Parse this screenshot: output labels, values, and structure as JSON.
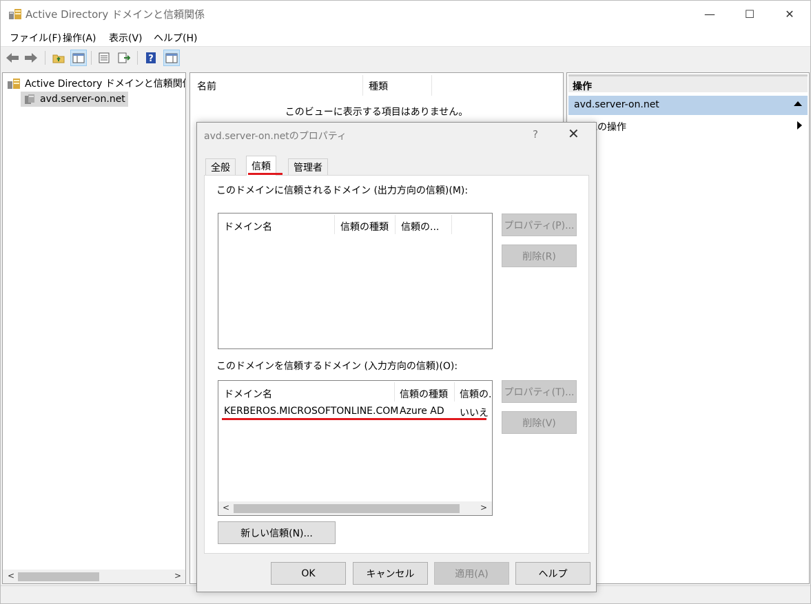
{
  "window": {
    "title": "Active Directory ドメインと信頼関係",
    "controls": {
      "minimize": "—",
      "maximize": "☐",
      "close": "✕"
    }
  },
  "menu": {
    "items": [
      "ファイル(F)",
      "操作(A)",
      "表示(V)",
      "ヘルプ(H)"
    ]
  },
  "toolbar": {
    "icons": [
      "back-arrow-icon",
      "forward-arrow-icon",
      "up-folder-icon",
      "show-tree-icon",
      "properties-icon",
      "export-list-icon",
      "help-icon",
      "show-action-pane-icon"
    ]
  },
  "tree": {
    "root_label": "Active Directory ドメインと信頼関係 [ A",
    "child_label": "avd.server-on.net"
  },
  "list": {
    "columns": [
      "名前",
      "種類"
    ],
    "empty_message": "このビューに表示する項目はありません。"
  },
  "actions": {
    "header": "操作",
    "domain": "avd.server-on.net",
    "other_actions": "他の操作"
  },
  "dialog": {
    "title": "avd.server-on.netのプロパティ",
    "help": "?",
    "close": "✕",
    "tabs": [
      "全般",
      "信頼",
      "管理者"
    ],
    "selected_tab": "信頼",
    "outgoing": {
      "label": "このドメインに信頼されるドメイン (出力方向の信頼)(M):",
      "columns": [
        "ドメイン名",
        "信頼の種類",
        "信頼の..."
      ],
      "rows": [],
      "properties_button": "プロパティ(P)...",
      "remove_button": "削除(R)"
    },
    "incoming": {
      "label": "このドメインを信頼するドメイン (入力方向の信頼)(O):",
      "columns": [
        "ドメイン名",
        "信頼の種類",
        "信頼の."
      ],
      "rows": [
        {
          "domain": "KERBEROS.MICROSOFTONLINE.COM",
          "type": "Azure AD",
          "transitive": "いいえ"
        }
      ],
      "properties_button": "プロパティ(T)...",
      "remove_button": "削除(V)"
    },
    "new_trust_button": "新しい信頼(N)...",
    "buttons": {
      "ok": "OK",
      "cancel": "キャンセル",
      "apply": "適用(A)",
      "help": "ヘルプ"
    }
  },
  "colors": {
    "highlight_red": "#e0191e",
    "action_selected": "#b9d1ea"
  }
}
